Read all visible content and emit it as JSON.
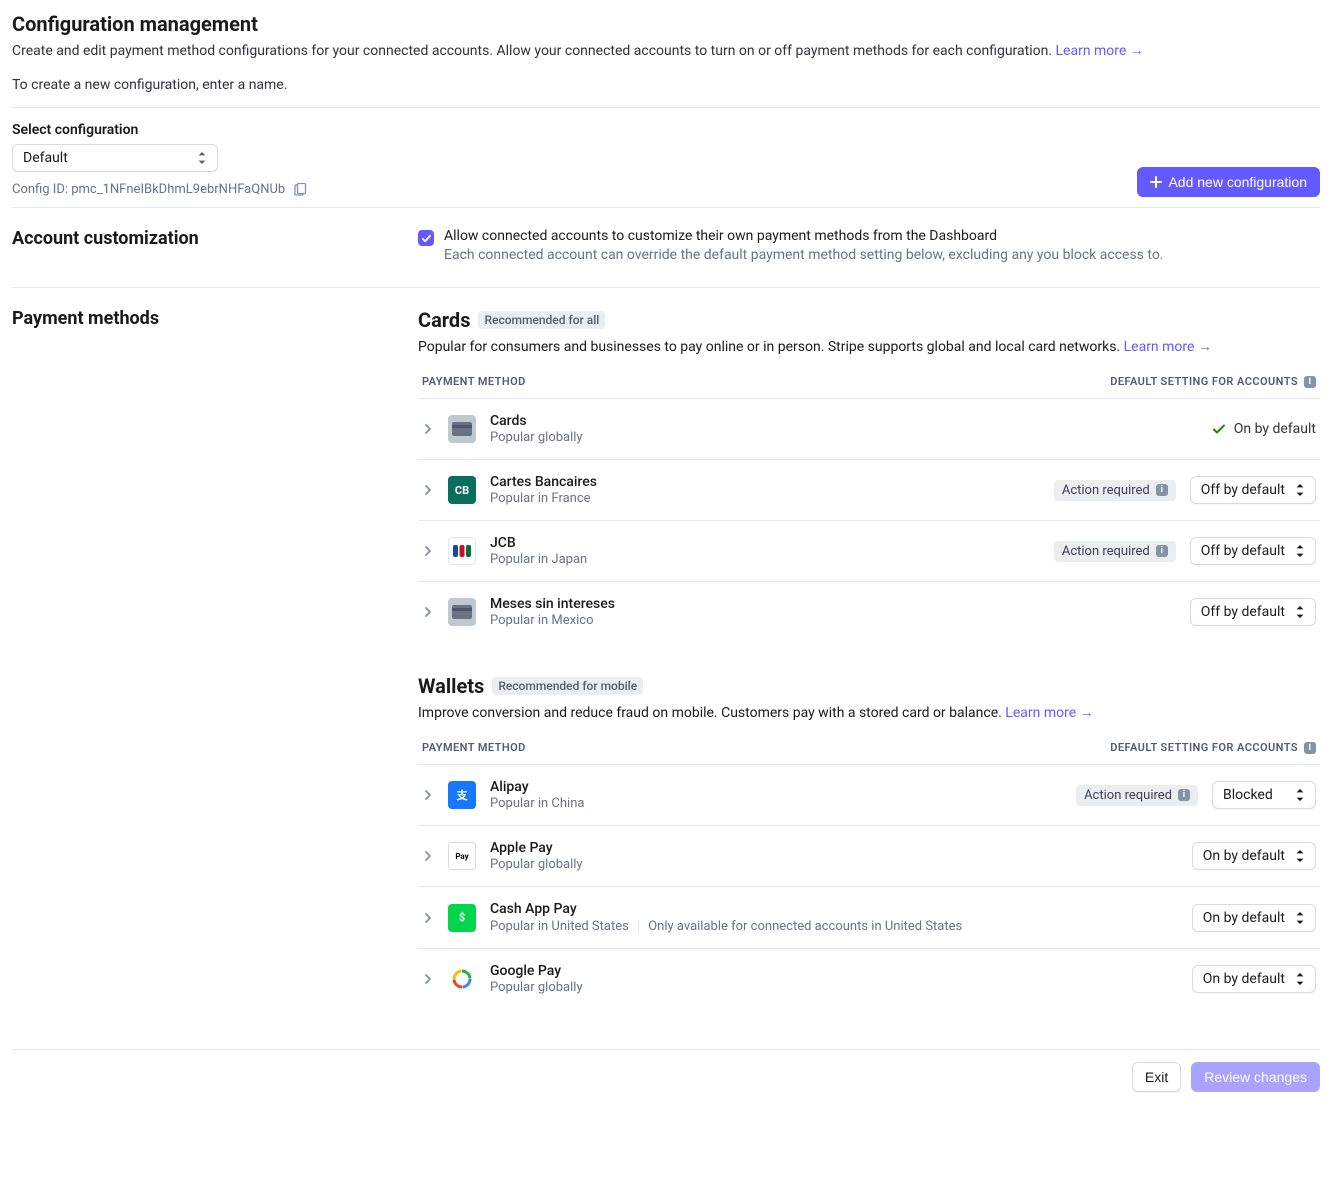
{
  "header": {
    "title": "Configuration management",
    "desc": "Create and edit payment method configurations for your connected accounts. Allow your connected accounts to turn on or off payment methods for each configuration.",
    "learn_more": "Learn more",
    "sub": "To create a new configuration, enter a name."
  },
  "config": {
    "select_label": "Select configuration",
    "selected": "Default",
    "id_label": "Config ID:",
    "id_value": "pmc_1NFneIBkDhmL9ebrNHFaQNUb",
    "add_button": "Add new configuration"
  },
  "account": {
    "heading": "Account customization",
    "check_label": "Allow connected accounts to customize their own payment methods from the Dashboard",
    "check_desc": "Each connected account can override the default payment method setting below, excluding any you block access to."
  },
  "pm_heading": "Payment methods",
  "table": {
    "col_method": "Payment method",
    "col_setting": "Default setting for accounts"
  },
  "badges": {
    "action_required": "Action required"
  },
  "states": {
    "on_default_text": "On by default",
    "off_default": "Off by default",
    "on_default": "On by default",
    "blocked": "Blocked"
  },
  "groups": [
    {
      "title": "Cards",
      "badge": "Recommended for all",
      "desc": "Popular for consumers and businesses to pay online or in person. Stripe supports global and local card networks.",
      "learn_more": "Learn more",
      "methods": [
        {
          "name": "Cards",
          "pop": "Popular globally",
          "state": "on_fixed",
          "action_required": false,
          "icon": "card",
          "icon_bg": "#c0c8d2",
          "icon_fg": "#6a7383"
        },
        {
          "name": "Cartes Bancaires",
          "pop": "Popular in France",
          "state": "off",
          "action_required": true,
          "icon": "cb",
          "icon_bg": "#0a6e5d",
          "icon_fg": "#ffffff",
          "icon_text": "CB"
        },
        {
          "name": "JCB",
          "pop": "Popular in Japan",
          "state": "off",
          "action_required": true,
          "icon": "jcb",
          "icon_bg": "#ffffff"
        },
        {
          "name": "Meses sin intereses",
          "pop": "Popular in Mexico",
          "state": "off",
          "action_required": false,
          "icon": "card",
          "icon_bg": "#c0c8d2",
          "icon_fg": "#6a7383"
        }
      ]
    },
    {
      "title": "Wallets",
      "badge": "Recommended for mobile",
      "desc": "Improve conversion and reduce fraud on mobile. Customers pay with a stored card or balance.",
      "learn_more": "Learn more",
      "methods": [
        {
          "name": "Alipay",
          "pop": "Popular in China",
          "state": "blocked",
          "action_required": true,
          "icon": "alipay",
          "icon_bg": "#1677ff",
          "icon_fg": "#ffffff",
          "icon_text": "支"
        },
        {
          "name": "Apple Pay",
          "pop": "Popular globally",
          "state": "on",
          "action_required": false,
          "icon": "apple",
          "icon_bg": "#ffffff",
          "icon_fg": "#000000",
          "icon_text": "Pay"
        },
        {
          "name": "Cash App Pay",
          "pop": "Popular in United States",
          "note": "Only available for connected accounts in United States",
          "state": "on",
          "action_required": false,
          "icon": "cashapp",
          "icon_bg": "#00d54b",
          "icon_fg": "#ffffff",
          "icon_text": "$"
        },
        {
          "name": "Google Pay",
          "pop": "Popular globally",
          "state": "on",
          "action_required": false,
          "icon": "google",
          "icon_bg": "#ffffff",
          "icon_fg": "#000000",
          "icon_text": "G"
        }
      ]
    }
  ],
  "footer": {
    "exit": "Exit",
    "review": "Review changes"
  }
}
